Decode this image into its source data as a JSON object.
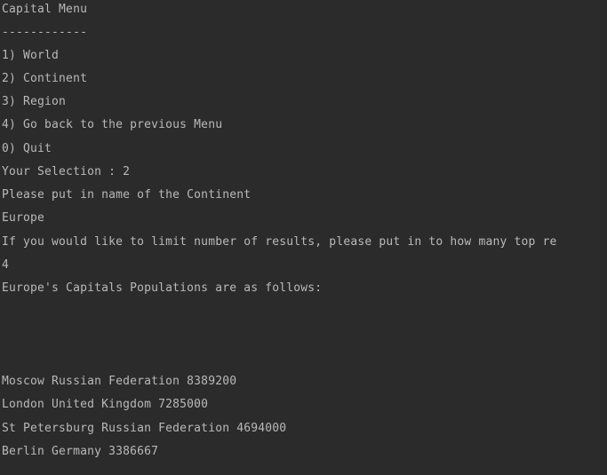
{
  "console": {
    "lines": [
      "Capital Menu",
      "------------",
      "1) World",
      "2) Continent",
      "3) Region",
      "4) Go back to the previous Menu",
      "0) Quit",
      "Your Selection : 2",
      "Please put in name of the Continent",
      "Europe",
      "If you would like to limit number of results, please put in to how many top re",
      "4",
      "Europe's Capitals Populations are as follows:",
      "",
      "",
      "",
      "Moscow Russian Federation 8389200",
      "London United Kingdom 7285000",
      "St Petersburg Russian Federation 4694000",
      "Berlin Germany 3386667"
    ]
  }
}
